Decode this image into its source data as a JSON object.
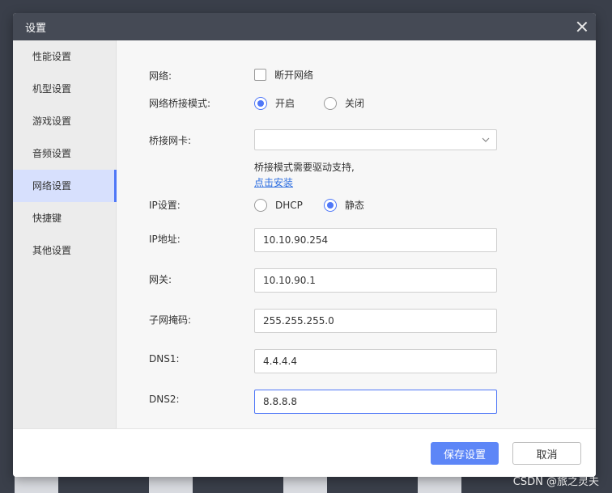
{
  "dialog": {
    "title": "设置"
  },
  "sidebar": {
    "items": [
      {
        "label": "性能设置"
      },
      {
        "label": "机型设置"
      },
      {
        "label": "游戏设置"
      },
      {
        "label": "音频设置"
      },
      {
        "label": "网络设置"
      },
      {
        "label": "快捷键"
      },
      {
        "label": "其他设置"
      }
    ],
    "active_index": 4
  },
  "network": {
    "network_label": "网络:",
    "disconnect_label": "断开网络",
    "disconnect_checked": false,
    "bridge_mode_label": "网络桥接模式:",
    "bridge_on_label": "开启",
    "bridge_off_label": "关闭",
    "bridge_mode_selected": "开启",
    "bridge_nic_label": "桥接网卡:",
    "bridge_nic_value": "",
    "driver_hint": "桥接模式需要驱动支持,",
    "install_link": "点击安装",
    "ip_setting_label": "IP设置:",
    "dhcp_label": "DHCP",
    "static_label": "静态",
    "ip_mode_selected": "静态",
    "ip_address_label": "IP地址:",
    "ip_address_value": "10.10.90.254",
    "gateway_label": "网关:",
    "gateway_value": "10.10.90.1",
    "subnet_label": "子网掩码:",
    "subnet_value": "255.255.255.0",
    "dns1_label": "DNS1:",
    "dns1_value": "4.4.4.4",
    "dns2_label": "DNS2:",
    "dns2_value": "8.8.8.8"
  },
  "footer": {
    "save_label": "保存设置",
    "cancel_label": "取消"
  },
  "watermark": "CSDN @旅之灵夫",
  "colors": {
    "accent": "#4f77f7",
    "primary_button": "#5d86f7",
    "titlebar": "#454a55",
    "sidebar_active_bg": "#d7e0fd",
    "link": "#2f6fe0"
  },
  "icons": {
    "close": "close-icon",
    "dropdown": "chevron-down-icon"
  }
}
